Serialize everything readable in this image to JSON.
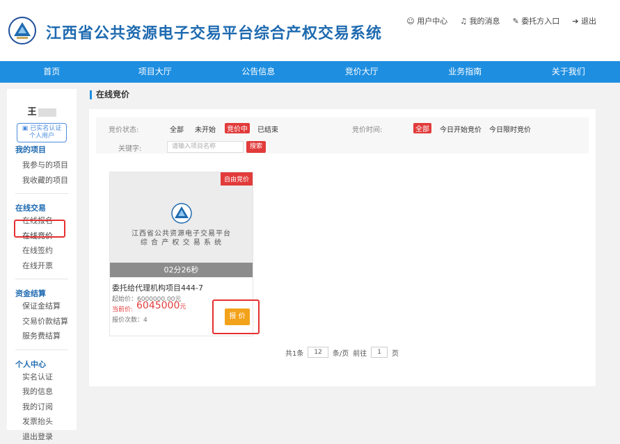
{
  "header": {
    "title": "江西省公共资源电子交易平台综合产权交易系统",
    "links": [
      "用户中心",
      "我的消息",
      "委托方入口",
      "退出"
    ]
  },
  "nav": [
    "首页",
    "项目大厅",
    "公告信息",
    "竞价大厅",
    "业务指南",
    "关于我们"
  ],
  "sidebar": {
    "user_name": "王",
    "auth_badge_line1": "已实名认证",
    "auth_badge_line2": "个人用户",
    "sections": [
      {
        "title": "我的项目",
        "items": [
          "我参与的项目",
          "我收藏的项目"
        ]
      },
      {
        "title": "在线交易",
        "items": [
          "在线报名",
          "在线竞价",
          "在线签约",
          "在线开票"
        ]
      },
      {
        "title": "资金结算",
        "items": [
          "保证金结算",
          "交易价款结算",
          "服务费结算"
        ]
      },
      {
        "title": "个人中心",
        "items": [
          "实名认证",
          "我的信息",
          "我的订阅",
          "发票抬头",
          "退出登录"
        ]
      }
    ]
  },
  "main": {
    "title": "在线竞价",
    "filter": {
      "status_label": "竞价状态:",
      "status_opts": [
        "全部",
        "未开始",
        "竞价中",
        "已结束"
      ],
      "time_label": "竞价时间:",
      "time_opts": [
        "全部",
        "今日开始竞价",
        "今日限时竞价"
      ],
      "keyword_label": "关键字:",
      "keyword_placeholder": "请输入项目名称",
      "search_btn": "搜索"
    },
    "card": {
      "tag": "自由竞价",
      "org_line1": "江西省公共资源电子交易平台",
      "org_line2": "综 合 产 权 交 易 系 统",
      "countdown": "02分26秒",
      "project_name": "委托给代理机构项目444-7",
      "start_price": "起始价：6000000.00元",
      "current_price_label": "当前价:",
      "current_price": "6045000",
      "current_price_unit": "元",
      "bid_count": "报价次数：4",
      "bid_btn": "报 价"
    },
    "pager": {
      "total": "共1条",
      "page_size": "12",
      "page_size_suffix": "条/页",
      "goto_prefix": "前往",
      "goto_page": "1",
      "goto_suffix": "页"
    }
  },
  "colors": {
    "nav_bg": "#1e8ee0",
    "accent_red": "#e23b3b",
    "bid_orange": "#f3a21b",
    "title_blue": "#1e6ab0"
  }
}
